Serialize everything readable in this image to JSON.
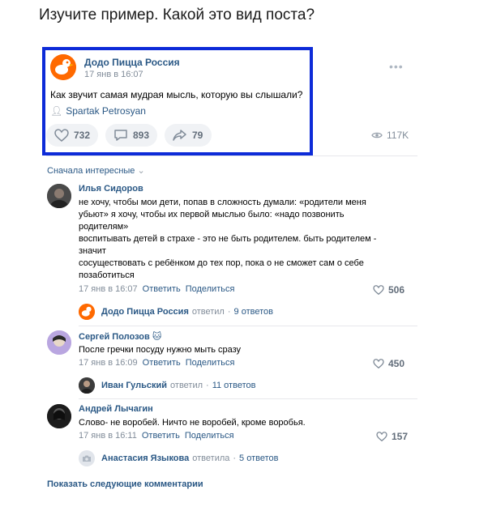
{
  "heading": "Изучите пример. Какой это вид поста?",
  "post": {
    "author": "Додо Пицца Россия",
    "date": "17 янв в 16:07",
    "text": "Как звучит самая мудрая мысль, которую вы слышали?",
    "signer": "Spartak Petrosyan",
    "likes": "732",
    "comments": "893",
    "shares": "79",
    "views": "117K",
    "more": "•••"
  },
  "comments_section": {
    "sort_label": "Сначала интересные",
    "show_more": "Показать следующие комментарии",
    "items": [
      {
        "name": "Илья Сидоров",
        "lines": [
          "не хочу, чтобы мои дети, попав в сложность думали: «родители меня",
          "убьют» я хочу, чтобы их первой мыслью было: «надо позвонить",
          "родителям»",
          "воспитывать детей в страхе - это не быть родителем. быть родителем -",
          "значит",
          "сосуществовать с ребёнком до тех пор, пока о не сможет сам о себе",
          "позаботиться"
        ],
        "date": "17 янв в 16:07",
        "reply_label": "Ответить",
        "share_label": "Поделиться",
        "likes": "506",
        "thread": {
          "name": "Додо Пицца Россия",
          "verb": "ответил",
          "count": "9 ответов"
        }
      },
      {
        "name": "Сергей Полозов",
        "badge": "🐱",
        "lines": [
          "После гречки посуду нужно мыть сразу"
        ],
        "date": "17 янв в 16:09",
        "reply_label": "Ответить",
        "share_label": "Поделиться",
        "likes": "450",
        "thread": {
          "name": "Иван Гульский",
          "verb": "ответил",
          "count": "11 ответов"
        }
      },
      {
        "name": "Андрей Лычагин",
        "lines": [
          "Слово- не воробей. Ничто не воробей, кроме воробья."
        ],
        "date": "17 янв в 16:11",
        "reply_label": "Ответить",
        "share_label": "Поделиться",
        "likes": "157",
        "thread": {
          "name": "Анастасия Языкова",
          "verb": "ответила",
          "count": "5 ответов"
        }
      }
    ]
  },
  "colors": {
    "highlight_border": "#0d2bd8",
    "link": "#2a5885",
    "muted": "#818c99",
    "brand": "#ff6900"
  }
}
